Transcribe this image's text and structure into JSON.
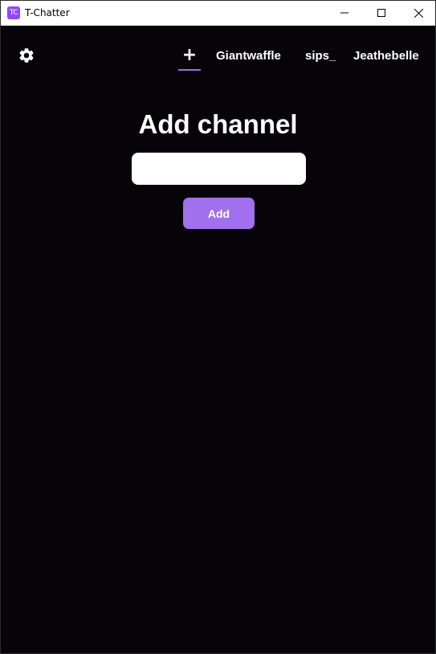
{
  "window": {
    "title": "T-Chatter",
    "app_icon_text": "TC"
  },
  "header": {
    "settings_icon": "gear-icon",
    "add_tab_label": "+",
    "tabs": [
      {
        "label": "Giantwaffle"
      },
      {
        "label": "sips_"
      },
      {
        "label": "Jeathebelle"
      }
    ]
  },
  "main": {
    "heading": "Add channel",
    "channel_input": {
      "value": "",
      "placeholder": ""
    },
    "add_button_label": "Add"
  },
  "colors": {
    "background": "#060408",
    "accent": "#a070ee",
    "text": "#ffffff"
  }
}
